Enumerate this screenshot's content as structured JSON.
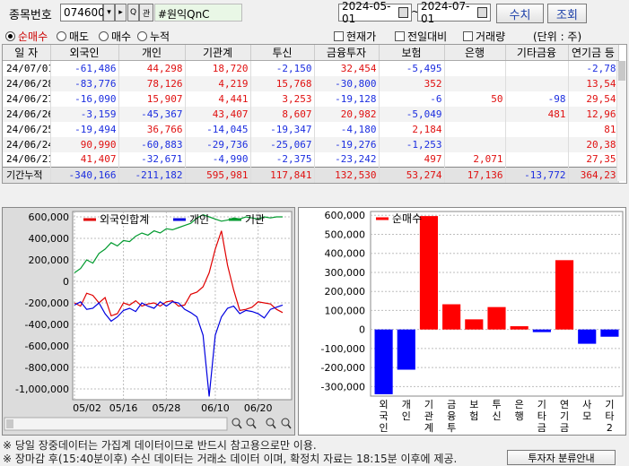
{
  "toolbar": {
    "code_label": "종목번호",
    "code_value": "074600",
    "nav_down": "▾",
    "nav_next": "▸",
    "search_glyph": "Q",
    "chart_glyph": "관",
    "stock_name": "#원익QnC",
    "date_from": "2024-05-01",
    "date_sep": "~",
    "date_to": "2024-07-01",
    "btn_query_add": "수치",
    "btn_query": "조회"
  },
  "options": {
    "radios": [
      {
        "label": "순매수",
        "selected": true
      },
      {
        "label": "매도",
        "selected": false
      },
      {
        "label": "매수",
        "selected": false
      },
      {
        "label": "누적",
        "selected": false
      }
    ],
    "checks": [
      {
        "label": "현재가"
      },
      {
        "label": "전일대비"
      },
      {
        "label": "거래량"
      }
    ],
    "unit": "(단위 : 주)"
  },
  "table": {
    "headers": [
      "일 자",
      "외국인",
      "개인",
      "기관계",
      "투신",
      "금융투자",
      "보험",
      "은행",
      "기타금융",
      "연기금 등"
    ],
    "rows": [
      [
        "24/07/01",
        "-61,486",
        "44,298",
        "18,720",
        "-2,150",
        "32,454",
        "-5,495",
        "",
        "",
        "-2,78"
      ],
      [
        "24/06/28",
        "-83,776",
        "78,126",
        "4,219",
        "15,768",
        "-30,800",
        "352",
        "",
        "",
        "13,54"
      ],
      [
        "24/06/27",
        "-16,090",
        "15,907",
        "4,441",
        "3,253",
        "-19,128",
        "-6",
        "50",
        "-98",
        "29,54"
      ],
      [
        "24/06/26",
        "-3,159",
        "-45,367",
        "43,407",
        "8,607",
        "20,982",
        "-5,049",
        "",
        "481",
        "12,96"
      ],
      [
        "24/06/25",
        "-19,494",
        "36,766",
        "-14,045",
        "-19,347",
        "-4,180",
        "2,184",
        "",
        "",
        "81"
      ],
      [
        "24/06/24",
        "90,990",
        "-60,883",
        "-29,736",
        "-25,067",
        "-19,276",
        "-1,253",
        "",
        "",
        "20,38"
      ],
      [
        "24/06/21",
        "41,407",
        "-32,671",
        "-4,990",
        "-2,375",
        "-23,242",
        "497",
        "2,071",
        "",
        "27,35"
      ]
    ],
    "total": [
      "기간누적",
      "-340,166",
      "-211,182",
      "595,981",
      "117,841",
      "132,530",
      "53,274",
      "17,136",
      "-13,772",
      "364,23"
    ]
  },
  "chart_data": [
    {
      "type": "line",
      "legend": [
        "외국인합계",
        "개인",
        "기관"
      ],
      "colors": [
        "#e00000",
        "#0000e0",
        "#009a2e"
      ],
      "y_ticks": [
        "600,000",
        "400,000",
        "200,000",
        "0",
        "-200,000",
        "-400,000",
        "-600,000",
        "-800,000",
        "-1,000,000"
      ],
      "ylim": [
        -1100000,
        650000
      ],
      "x_ticks": [
        "05/02",
        "05/16",
        "05/28",
        "06/10",
        "06/20"
      ],
      "series": [
        {
          "name": "외국인합계",
          "values": [
            -200000,
            -230000,
            -110000,
            -130000,
            -200000,
            -150000,
            -320000,
            -300000,
            -200000,
            -220000,
            -180000,
            -230000,
            -210000,
            -200000,
            -230000,
            -190000,
            -180000,
            -230000,
            -220000,
            -120000,
            -100000,
            -50000,
            80000,
            300000,
            470000,
            150000,
            -80000,
            -270000,
            -260000,
            -240000,
            -190000,
            -200000,
            -210000,
            -260000,
            -290000
          ]
        },
        {
          "name": "개인",
          "values": [
            -220000,
            -190000,
            -260000,
            -250000,
            -200000,
            -300000,
            -370000,
            -330000,
            -270000,
            -250000,
            -280000,
            -200000,
            -230000,
            -250000,
            -190000,
            -230000,
            -190000,
            -200000,
            -260000,
            -290000,
            -330000,
            -500000,
            -1070000,
            -500000,
            -330000,
            -250000,
            -230000,
            -300000,
            -270000,
            -280000,
            -300000,
            -340000,
            -260000,
            -240000,
            -220000
          ]
        },
        {
          "name": "기관",
          "values": [
            80000,
            120000,
            200000,
            170000,
            260000,
            300000,
            360000,
            330000,
            380000,
            370000,
            420000,
            450000,
            430000,
            470000,
            450000,
            490000,
            480000,
            500000,
            520000,
            540000,
            590000,
            620000,
            600000,
            580000,
            560000,
            570000,
            590000,
            580000,
            600000,
            590000,
            580000,
            600000,
            590000,
            600000,
            600000
          ]
        }
      ]
    },
    {
      "type": "bar",
      "legend": [
        "순매수"
      ],
      "y_ticks": [
        "600,000",
        "500,000",
        "400,000",
        "300,000",
        "200,000",
        "100,000",
        "0",
        "-100,000",
        "-200,000",
        "-300,000"
      ],
      "ylim": [
        -350000,
        620000
      ],
      "categories": [
        "외국인",
        "개인",
        "기관계",
        "금융투",
        "보험",
        "투신",
        "은행",
        "기타금",
        "연기금",
        "사모",
        "기타2"
      ],
      "values": [
        -340166,
        -211182,
        595981,
        132530,
        53274,
        117841,
        17136,
        -13772,
        364230,
        -75000,
        -38000
      ]
    }
  ],
  "footer": {
    "line1": "※ 당일 장중데이터는 가집계 데이터이므로 반드시 참고용으로만 이용.",
    "line2": "※ 장마감 후(15:40분이후) 수신 데이터는 거래소 데이터 이며, 확정치 자료는 18:15분 이후에 제공.",
    "btn": "투자자 분류안내"
  }
}
